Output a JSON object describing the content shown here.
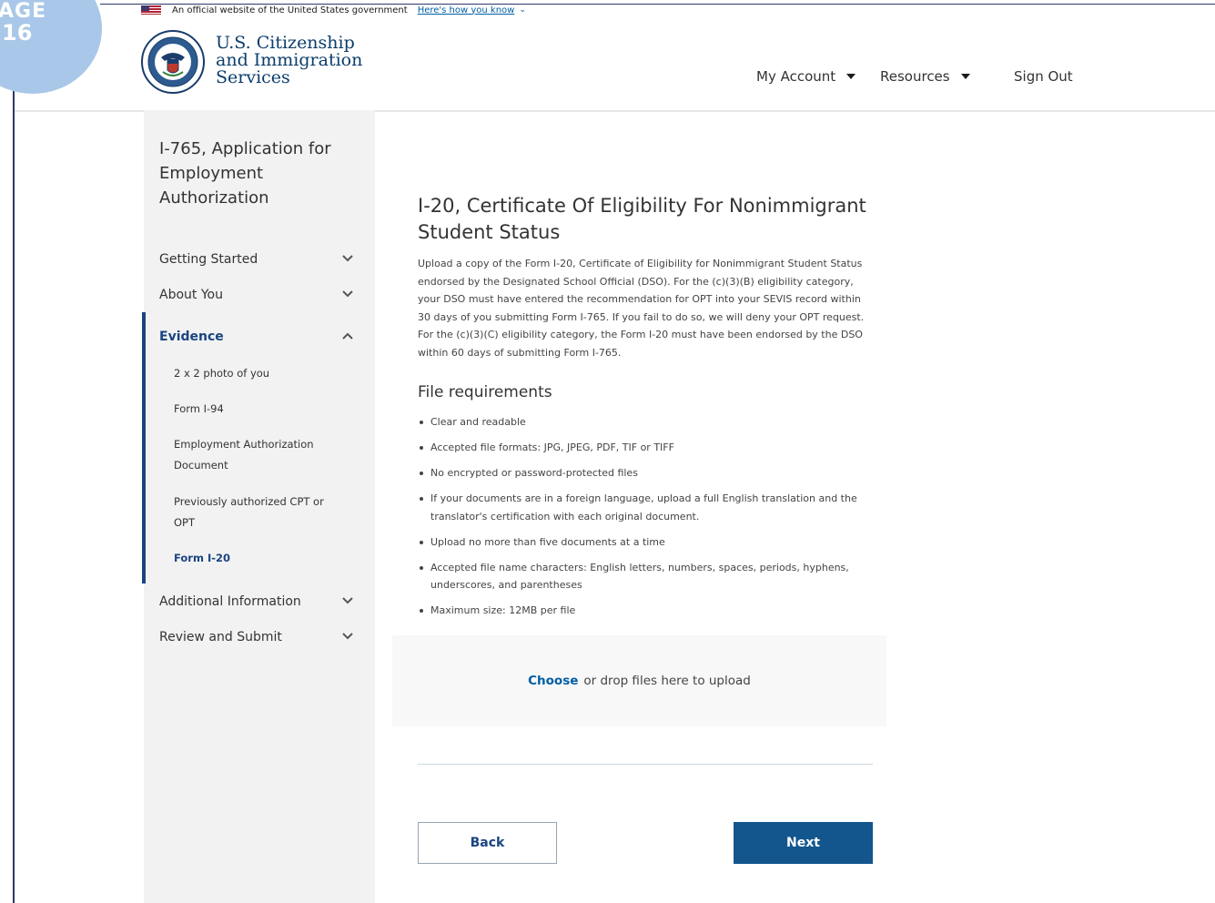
{
  "page_badge": {
    "line1": "AGE",
    "line2": "16"
  },
  "gov_banner": {
    "text": "An official website of the United States government",
    "link": "Here's how you know"
  },
  "header": {
    "agency_line1": "U.S. Citizenship",
    "agency_line2": "and Immigration",
    "agency_line3": "Services"
  },
  "nav": {
    "my_account": "My Account",
    "resources": "Resources",
    "sign_out": "Sign Out"
  },
  "sidebar": {
    "form_title": "I-765, Application for Employment Authorization",
    "sections": [
      "Getting Started",
      "About You",
      "Evidence",
      "Additional Information",
      "Review and Submit"
    ],
    "evidence_items": [
      "2 x 2 photo of you",
      "Form I-94",
      "Employment Authorization Document",
      "Previously authorized CPT or OPT",
      "Form I-20"
    ]
  },
  "main": {
    "title": "I-20, Certificate Of Eligibility For Nonimmigrant Student Status",
    "intro": "Upload a copy of the Form I-20, Certificate of Eligibility for Nonimmigrant Student Status endorsed by the Designated School Official (DSO). For the (c)(3)(B) eligibility category, your DSO must have entered the recommendation for OPT into your SEVIS record within 30 days of you submitting Form I-765. If you fail to do so, we will deny your OPT request. For the (c)(3)(C) eligibility category, the Form I-20 must have been endorsed by the DSO within 60 days of submitting Form I-765.",
    "requirements_title": "File requirements",
    "requirements": [
      "Clear and readable",
      "Accepted file formats: JPG, JPEG, PDF, TIF or TIFF",
      "No encrypted or password-protected files",
      "If your documents are in a foreign language, upload a full English translation and the translator's certification with each original document.",
      "Upload no more than five documents at a time",
      "Accepted file name characters: English letters, numbers, spaces, periods, hyphens, underscores, and parentheses",
      "Maximum size: 12MB per file"
    ],
    "upload_choose": "Choose",
    "upload_rest": "or drop files here to upload",
    "back_label": "Back",
    "next_label": "Next"
  },
  "colors": {
    "accent": "#1a4480",
    "primary_button": "#12568d",
    "link": "#005ea2",
    "sidebar_bg": "#f2f2f2"
  },
  "icons": [
    "us-flag-icon",
    "dhs-seal-icon",
    "caret-down-icon",
    "chevron-down-icon",
    "chevron-up-icon"
  ]
}
